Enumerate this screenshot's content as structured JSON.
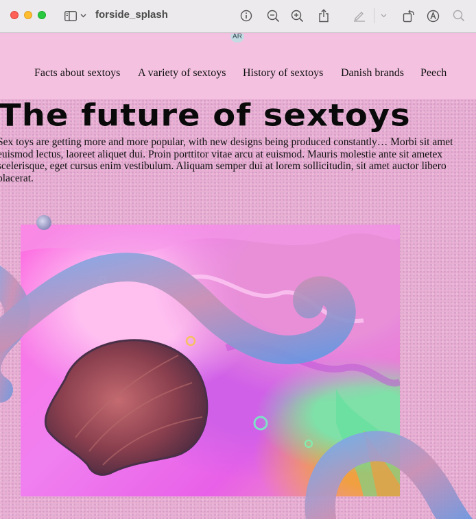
{
  "window": {
    "title": "forside_splash",
    "avatar_initials": "AR"
  },
  "nav": {
    "items": [
      {
        "label": "Facts about sextoys"
      },
      {
        "label": "A variety of sextoys"
      },
      {
        "label": "History of sextoys"
      },
      {
        "label": "Danish brands"
      },
      {
        "label": "Peech"
      }
    ]
  },
  "hero": {
    "title": "The future of sextoys",
    "intro": "Sex toys are getting more and more popular, with new designs being produced constantly… Morbi sit amet euismod lectus, laoreet aliquet dui. Proin porttitor vitae arcu at euismod. Mauris molestie ante sit ametex scelerisque, eget cursus enim vestibulum. Aliquam semper dui at lorem sollicitudin, sit amet auctor libero placerat."
  },
  "colors": {
    "page_background": "#eab0d4",
    "nav_background": "#f4c2e0",
    "traffic_close": "#fe5f57",
    "traffic_minimize": "#febc2e",
    "traffic_zoom": "#28c840"
  },
  "icons": {
    "toolbar": [
      "sidebar-icon",
      "chevron-down-icon",
      "info-icon",
      "zoom-out-icon",
      "zoom-in-icon",
      "share-icon",
      "markup-pen-icon",
      "chevron-down-icon",
      "rotate-icon",
      "annotate-icon",
      "search-icon"
    ]
  }
}
